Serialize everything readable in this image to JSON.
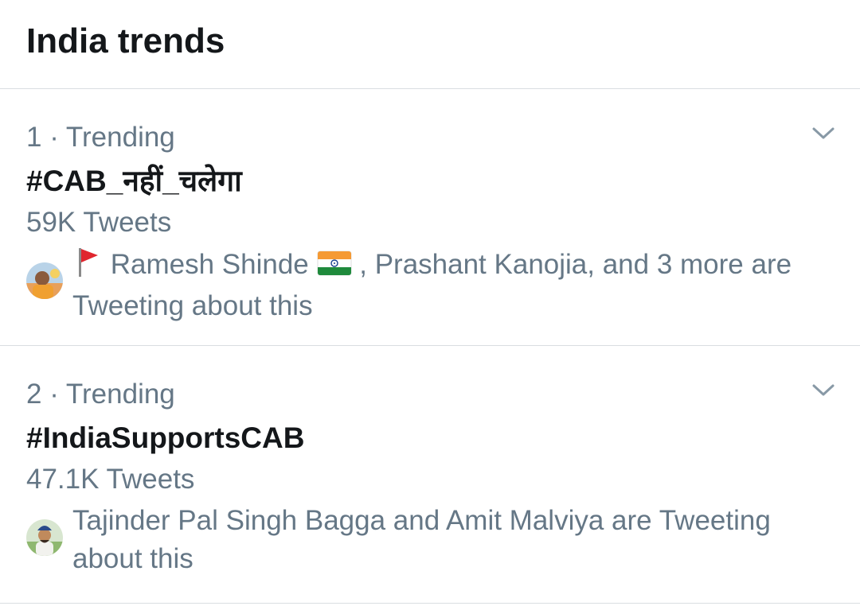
{
  "header": {
    "title": "India trends"
  },
  "trends": [
    {
      "rank_label": "1 · Trending",
      "name": "#CAB_नहीं_चलेगा",
      "count": "59K Tweets",
      "context": {
        "person1": "Ramesh Shinde",
        "rest": ", Prashant Kanojia, and 3 more are Tweeting about this"
      },
      "leading_icon": "red-flag-icon",
      "trailing_icon": "india-flag-icon"
    },
    {
      "rank_label": "2 · Trending",
      "name": "#IndiaSupportsCAB",
      "count": "47.1K Tweets",
      "context": {
        "text": "Tajinder Pal Singh Bagga and Amit Malviya are Tweeting about this"
      }
    }
  ],
  "colors": {
    "primary_text": "#14171a",
    "secondary_text": "#657786",
    "divider": "#d9dde1",
    "chevron": "#8899a6"
  }
}
